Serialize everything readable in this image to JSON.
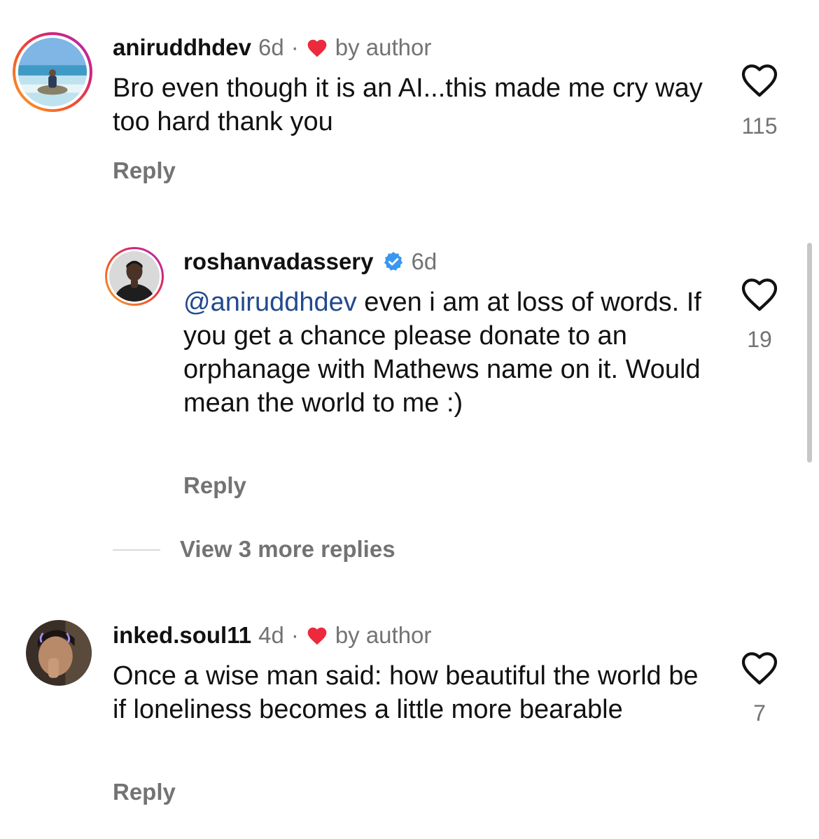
{
  "comments": [
    {
      "username": "aniruddhdev",
      "time": "6d",
      "separator": "·",
      "liked_by_author_label": "by author",
      "text": "Bro even though it is an AI...this made me cry way too hard thank you",
      "likes": "115",
      "reply_label": "Reply"
    },
    {
      "username": "roshanvadassery",
      "verified": true,
      "time": "6d",
      "mention": "@aniruddhdev",
      "text": " even i am at loss of words. If you get a chance please donate to an orphanage with Mathews name on it. Would mean the world to me :)",
      "likes": "19",
      "reply_label": "Reply"
    },
    {
      "username": "inked.soul11",
      "time": "4d",
      "separator": "·",
      "liked_by_author_label": "by author",
      "text": "Once a wise man said: how beautiful the world be if loneliness becomes a little more bearable",
      "likes": "7",
      "reply_label": "Reply"
    }
  ],
  "view_more_replies": "View 3 more replies",
  "colors": {
    "heart_red": "#ed2a3d",
    "verified_blue": "#3897f0",
    "mention_blue": "#224a8e",
    "secondary_text": "#737373"
  }
}
